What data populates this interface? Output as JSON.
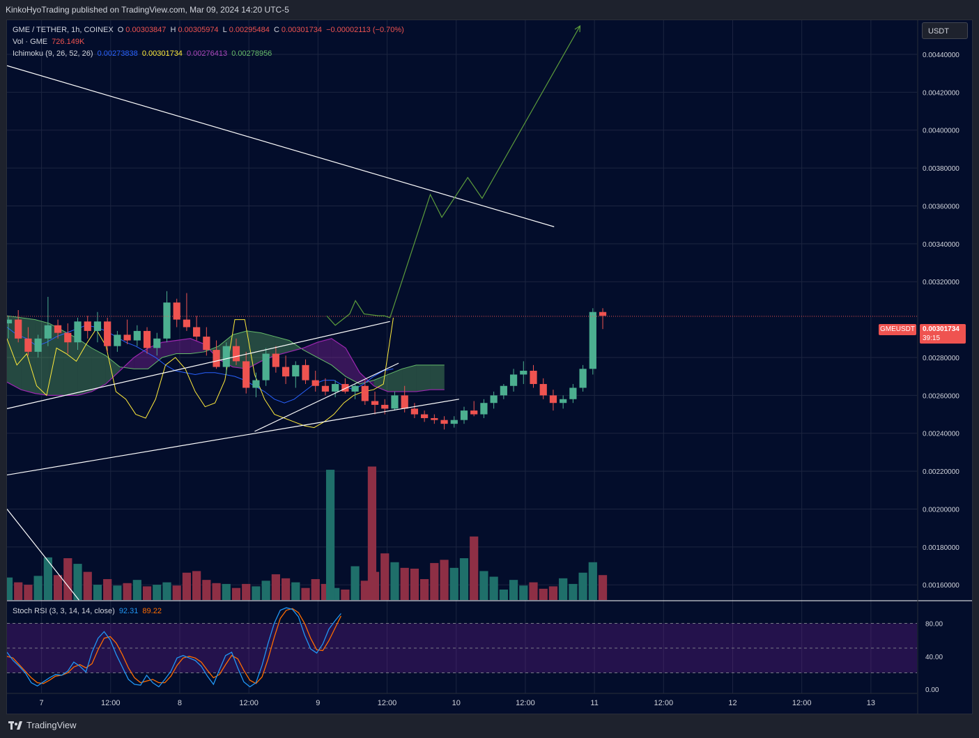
{
  "header": {
    "publisher": "KinkoHyoTrading published on TradingView.com, Mar 09, 2024 14:20 UTC-5"
  },
  "legend": {
    "symbol": "GME / TETHER, 1h, COINEX",
    "o_label": "O",
    "o_value": "0.00303847",
    "h_label": "H",
    "h_value": "0.00305974",
    "l_label": "L",
    "l_value": "0.00295484",
    "c_label": "C",
    "c_value": "0.00301734",
    "change": "−0.00002113 (−0.70%)",
    "vol_label": "Vol · GME",
    "vol_value": "726.149K",
    "ichi_label": "Ichimoku (9, 26, 52, 26)",
    "ichi_values": [
      "0.00273838",
      "0.00301734",
      "0.00276413",
      "0.00278956"
    ],
    "stoch_label": "Stoch RSI (3, 3, 14, 14, close)",
    "stoch_k": "92.31",
    "stoch_d": "89.22"
  },
  "currency_button": "USDT",
  "price_badge": {
    "symbol": "GMEUSDT",
    "price": "0.00301734",
    "countdown": "39:15"
  },
  "brand": "TradingView",
  "colors": {
    "background": "#030d2b",
    "bull": "#26a69a",
    "bear": "#ef5350",
    "tenkan": "#2962ff",
    "kijun": "#ffeb3b",
    "span_a": "#9c27b0",
    "span_b": "#66bb6a",
    "stoch_k": "#2196f3",
    "stoch_d": "#ff6d00",
    "rsi_band": "#7b1fa2"
  },
  "chart_data": {
    "type": "candlestick",
    "price_axis": {
      "ticks": [
        0.0044,
        0.0042,
        0.004,
        0.0038,
        0.0036,
        0.0034,
        0.0032,
        0.0028,
        0.0026,
        0.0024,
        0.0022,
        0.002,
        0.0018,
        0.0016
      ],
      "tick_labels": [
        "0.00440000",
        "0.00420000",
        "0.00400000",
        "0.00380000",
        "0.00360000",
        "0.00340000",
        "0.00320000",
        "0.00280000",
        "0.00260000",
        "0.00240000",
        "0.00220000",
        "0.00200000",
        "0.00180000",
        "0.00160000"
      ],
      "ylim": [
        0.00152,
        0.00458
      ]
    },
    "time_axis": {
      "tick_labels": [
        "7",
        "12:00",
        "8",
        "12:00",
        "9",
        "12:00",
        "10",
        "12:00",
        "11",
        "12:00",
        "12",
        "12:00",
        "13"
      ],
      "tick_hours": [
        6,
        18,
        30,
        42,
        54,
        66,
        78,
        90,
        102,
        114,
        126,
        138,
        150
      ],
      "xlim_hours": [
        0,
        158
      ]
    },
    "current_price": 0.00301734,
    "candles": [
      [
        0.00298,
        0.00302,
        0.0029,
        0.003
      ],
      [
        0.003,
        0.00305,
        0.00288,
        0.0029
      ],
      [
        0.0029,
        0.00296,
        0.00281,
        0.00283
      ],
      [
        0.00283,
        0.00292,
        0.0028,
        0.0029
      ],
      [
        0.0029,
        0.00312,
        0.00286,
        0.00297
      ],
      [
        0.00297,
        0.003,
        0.0029,
        0.00293
      ],
      [
        0.00293,
        0.00298,
        0.00282,
        0.00288
      ],
      [
        0.00288,
        0.00301,
        0.00284,
        0.00299
      ],
      [
        0.00299,
        0.00302,
        0.0029,
        0.00294
      ],
      [
        0.00294,
        0.00304,
        0.00288,
        0.00299
      ],
      [
        0.00299,
        0.00301,
        0.00283,
        0.00286
      ],
      [
        0.00286,
        0.00294,
        0.00283,
        0.00292
      ],
      [
        0.00292,
        0.003,
        0.00287,
        0.00289
      ],
      [
        0.00289,
        0.00297,
        0.00286,
        0.00294
      ],
      [
        0.00294,
        0.00296,
        0.00282,
        0.00285
      ],
      [
        0.00285,
        0.00293,
        0.00281,
        0.0029
      ],
      [
        0.0029,
        0.00315,
        0.00288,
        0.00309
      ],
      [
        0.00309,
        0.00311,
        0.00296,
        0.003
      ],
      [
        0.003,
        0.00314,
        0.00294,
        0.00296
      ],
      [
        0.00296,
        0.00302,
        0.00289,
        0.00291
      ],
      [
        0.00291,
        0.00296,
        0.00281,
        0.00284
      ],
      [
        0.00284,
        0.00289,
        0.00274,
        0.00275
      ],
      [
        0.00275,
        0.00288,
        0.00271,
        0.00286
      ],
      [
        0.00286,
        0.0029,
        0.00276,
        0.00278
      ],
      [
        0.00278,
        0.00283,
        0.00261,
        0.00264
      ],
      [
        0.00264,
        0.00272,
        0.00259,
        0.00268
      ],
      [
        0.00268,
        0.00285,
        0.00265,
        0.00282
      ],
      [
        0.00282,
        0.00286,
        0.00272,
        0.00275
      ],
      [
        0.00275,
        0.00281,
        0.00266,
        0.0027
      ],
      [
        0.0027,
        0.00278,
        0.00264,
        0.00276
      ],
      [
        0.00276,
        0.00279,
        0.00266,
        0.00268
      ],
      [
        0.00268,
        0.00273,
        0.00262,
        0.00265
      ],
      [
        0.00265,
        0.00269,
        0.0026,
        0.00262
      ],
      [
        0.00262,
        0.00268,
        0.00259,
        0.00266
      ],
      [
        0.00266,
        0.00269,
        0.00261,
        0.00262
      ],
      [
        0.00262,
        0.00266,
        0.00258,
        0.00265
      ],
      [
        0.00265,
        0.00268,
        0.00255,
        0.00257
      ],
      [
        0.00257,
        0.00262,
        0.0025,
        0.00255
      ],
      [
        0.00255,
        0.00258,
        0.0025,
        0.00253
      ],
      [
        0.00253,
        0.00262,
        0.00252,
        0.0026
      ],
      [
        0.0026,
        0.00265,
        0.00251,
        0.00253
      ],
      [
        0.00253,
        0.00256,
        0.00248,
        0.0025
      ],
      [
        0.0025,
        0.00252,
        0.00246,
        0.00248
      ],
      [
        0.00248,
        0.0025,
        0.00245,
        0.00247
      ],
      [
        0.00247,
        0.00249,
        0.00242,
        0.00245
      ],
      [
        0.00245,
        0.00249,
        0.00243,
        0.00247
      ],
      [
        0.00247,
        0.00254,
        0.00245,
        0.00252
      ],
      [
        0.00252,
        0.00257,
        0.00249,
        0.0025
      ],
      [
        0.0025,
        0.00258,
        0.00248,
        0.00256
      ],
      [
        0.00256,
        0.00262,
        0.00253,
        0.0026
      ],
      [
        0.0026,
        0.00266,
        0.00258,
        0.00265
      ],
      [
        0.00265,
        0.00274,
        0.00262,
        0.00271
      ],
      [
        0.00271,
        0.00278,
        0.00266,
        0.00273
      ],
      [
        0.00273,
        0.00276,
        0.00264,
        0.00266
      ],
      [
        0.00266,
        0.00269,
        0.00258,
        0.0026
      ],
      [
        0.0026,
        0.00263,
        0.00252,
        0.00256
      ],
      [
        0.00256,
        0.0026,
        0.00253,
        0.00258
      ],
      [
        0.00258,
        0.00266,
        0.00256,
        0.00264
      ],
      [
        0.00264,
        0.00276,
        0.00262,
        0.00274
      ],
      [
        0.00274,
        0.00306,
        0.00271,
        0.00304
      ],
      [
        0.00304,
        0.00306,
        0.00295,
        0.00302
      ]
    ],
    "candle_start_hour": 0,
    "candle_hour_step": 1.72,
    "volume": {
      "ylim": [
        0,
        0.0026
      ],
      "values": [
        0.00028,
        0.00022,
        0.00019,
        0.0003,
        0.00053,
        0.00031,
        0.00052,
        0.00045,
        0.00035,
        0.00019,
        0.00026,
        0.00018,
        0.00021,
        0.00025,
        0.00017,
        0.00019,
        0.00022,
        0.00018,
        0.00034,
        0.00036,
        0.00025,
        0.00021,
        0.0002,
        0.00015,
        0.0002,
        0.00017,
        0.00024,
        0.00032,
        0.00027,
        0.00022,
        0.00015,
        0.00026,
        0.0002,
        0.00015,
        0.00013,
        0.00042,
        0.00024,
        0.00035,
        0.00058,
        0.00047,
        0.0004,
        0.00039,
        0.00026,
        0.00046,
        0.0005,
        0.0004,
        0.00052,
        0.00079,
        0.00036,
        0.00029,
        0.00013,
        0.00025,
        0.00018,
        0.00022,
        0.00014,
        0.00017,
        0.00027,
        0.0002,
        0.00034,
        0.00047,
        0.00031
      ],
      "spikes": [
        {
          "candle": 32,
          "value": 0.00162
        },
        {
          "candle": 36,
          "value": 0.00166
        }
      ]
    },
    "ichimoku": {
      "tenkan": [
        0.00296,
        0.00292,
        0.0029,
        0.00286,
        0.00288,
        0.00291,
        0.00293,
        0.00295,
        0.00297,
        0.00296,
        0.00294,
        0.00291,
        0.00288,
        0.00286,
        0.00283,
        0.0028,
        0.00276,
        0.00273,
        0.00272,
        0.00271,
        0.00272,
        0.00272,
        0.00271,
        0.0027,
        0.00268,
        0.00265,
        0.00262,
        0.00258,
        0.00256,
        0.00258,
        0.00262,
        0.00266,
        0.00268,
        0.00268,
        0.00265,
        0.00263,
        0.00266,
        0.0027,
        0.00273,
        0.00274
      ],
      "kijun": [
        0.0029,
        0.00276,
        0.00282,
        0.00265,
        0.0026,
        0.00285,
        0.00282,
        0.00278,
        0.00287,
        0.00295,
        0.00286,
        0.00262,
        0.00258,
        0.0025,
        0.00248,
        0.00258,
        0.00276,
        0.0028,
        0.00274,
        0.00262,
        0.00254,
        0.00256,
        0.00268,
        0.003,
        0.003,
        0.00271,
        0.00258,
        0.0025,
        0.00248,
        0.00246,
        0.00244,
        0.00243,
        0.00246,
        0.0025,
        0.00256,
        0.0026,
        0.00262,
        0.00263,
        0.00266,
        0.00301
      ],
      "span_a": [
        0.00302,
        0.00301,
        0.003,
        0.00298,
        0.00294,
        0.0029,
        0.00285,
        0.00281,
        0.00275,
        0.00274,
        0.00274,
        0.0028,
        0.00282,
        0.00282,
        0.00283,
        0.00286,
        0.00292,
        0.00294,
        0.00293,
        0.00291,
        0.00289,
        0.00284,
        0.0028,
        0.00276,
        0.0027,
        0.00266,
        0.00268,
        0.00271,
        0.00274,
        0.00276,
        0.00276,
        0.00276
      ],
      "span_b": [
        0.00267,
        0.00263,
        0.00261,
        0.0026,
        0.0026,
        0.0026,
        0.00262,
        0.00266,
        0.00273,
        0.0028,
        0.00285,
        0.00288,
        0.00289,
        0.0029,
        0.00287,
        0.00279,
        0.00275,
        0.00274,
        0.00278,
        0.00281,
        0.00283,
        0.00285,
        0.00288,
        0.0029,
        0.00285,
        0.00272,
        0.00265,
        0.00262,
        0.00262,
        0.00262,
        0.00263,
        0.00263
      ],
      "cloud_start_hour": 0,
      "cloud_hour_step": 2.45
    },
    "trendlines": [
      {
        "name": "upper-descending",
        "points": [
          [
            0,
            0.00434
          ],
          [
            95,
            0.00349
          ]
        ]
      },
      {
        "name": "lower-ascending",
        "points": [
          [
            0,
            0.00218
          ],
          [
            78.5,
            0.00258
          ]
        ]
      },
      {
        "name": "mid-ascending",
        "points": [
          [
            0,
            0.00253
          ],
          [
            66.5,
            0.00299
          ]
        ]
      },
      {
        "name": "short-ascending",
        "points": [
          [
            43,
            0.00241
          ],
          [
            68,
            0.00277
          ]
        ]
      },
      {
        "name": "stoch-diag",
        "points": [
          [
            0,
            0.002
          ],
          [
            12.5,
            0.00152
          ]
        ]
      }
    ],
    "projection": [
      [
        55.5,
        0.00302
      ],
      [
        57,
        0.00297
      ],
      [
        59.5,
        0.00303
      ],
      [
        60.5,
        0.0031
      ],
      [
        62,
        0.00303
      ],
      [
        64.5,
        0.00302
      ],
      [
        65.5,
        0.00302
      ],
      [
        66.5,
        0.00301
      ],
      [
        73.5,
        0.00366
      ],
      [
        75.5,
        0.00354
      ],
      [
        80,
        0.00375
      ],
      [
        82.5,
        0.00364
      ],
      [
        99.5,
        0.00455
      ]
    ],
    "stoch_rsi": {
      "ylim": [
        -5,
        105
      ],
      "ticks": [
        80,
        40,
        0
      ],
      "tick_labels": [
        "80.00",
        "40.00",
        "0.00"
      ],
      "band": [
        20,
        80
      ],
      "k": [
        45,
        35,
        28,
        20,
        8,
        4,
        9,
        14,
        18,
        17,
        22,
        33,
        28,
        21,
        45,
        62,
        70,
        60,
        42,
        27,
        12,
        6,
        5,
        17,
        8,
        3,
        12,
        22,
        38,
        41,
        38,
        35,
        28,
        16,
        6,
        24,
        41,
        45,
        26,
        9,
        3,
        8,
        29,
        56,
        80,
        96,
        99,
        97,
        88,
        66,
        49,
        44,
        55,
        73,
        83,
        92
      ],
      "d": [
        40,
        38,
        30,
        22,
        14,
        8,
        7,
        11,
        16,
        17,
        20,
        27,
        30,
        26,
        31,
        48,
        62,
        64,
        56,
        42,
        26,
        14,
        8,
        10,
        12,
        8,
        8,
        16,
        29,
        38,
        40,
        38,
        33,
        23,
        14,
        18,
        30,
        41,
        37,
        23,
        11,
        7,
        15,
        37,
        63,
        86,
        96,
        98,
        93,
        80,
        62,
        48,
        47,
        59,
        74,
        89
      ],
      "start_hour": 0,
      "hour_step": 1.9
    }
  }
}
